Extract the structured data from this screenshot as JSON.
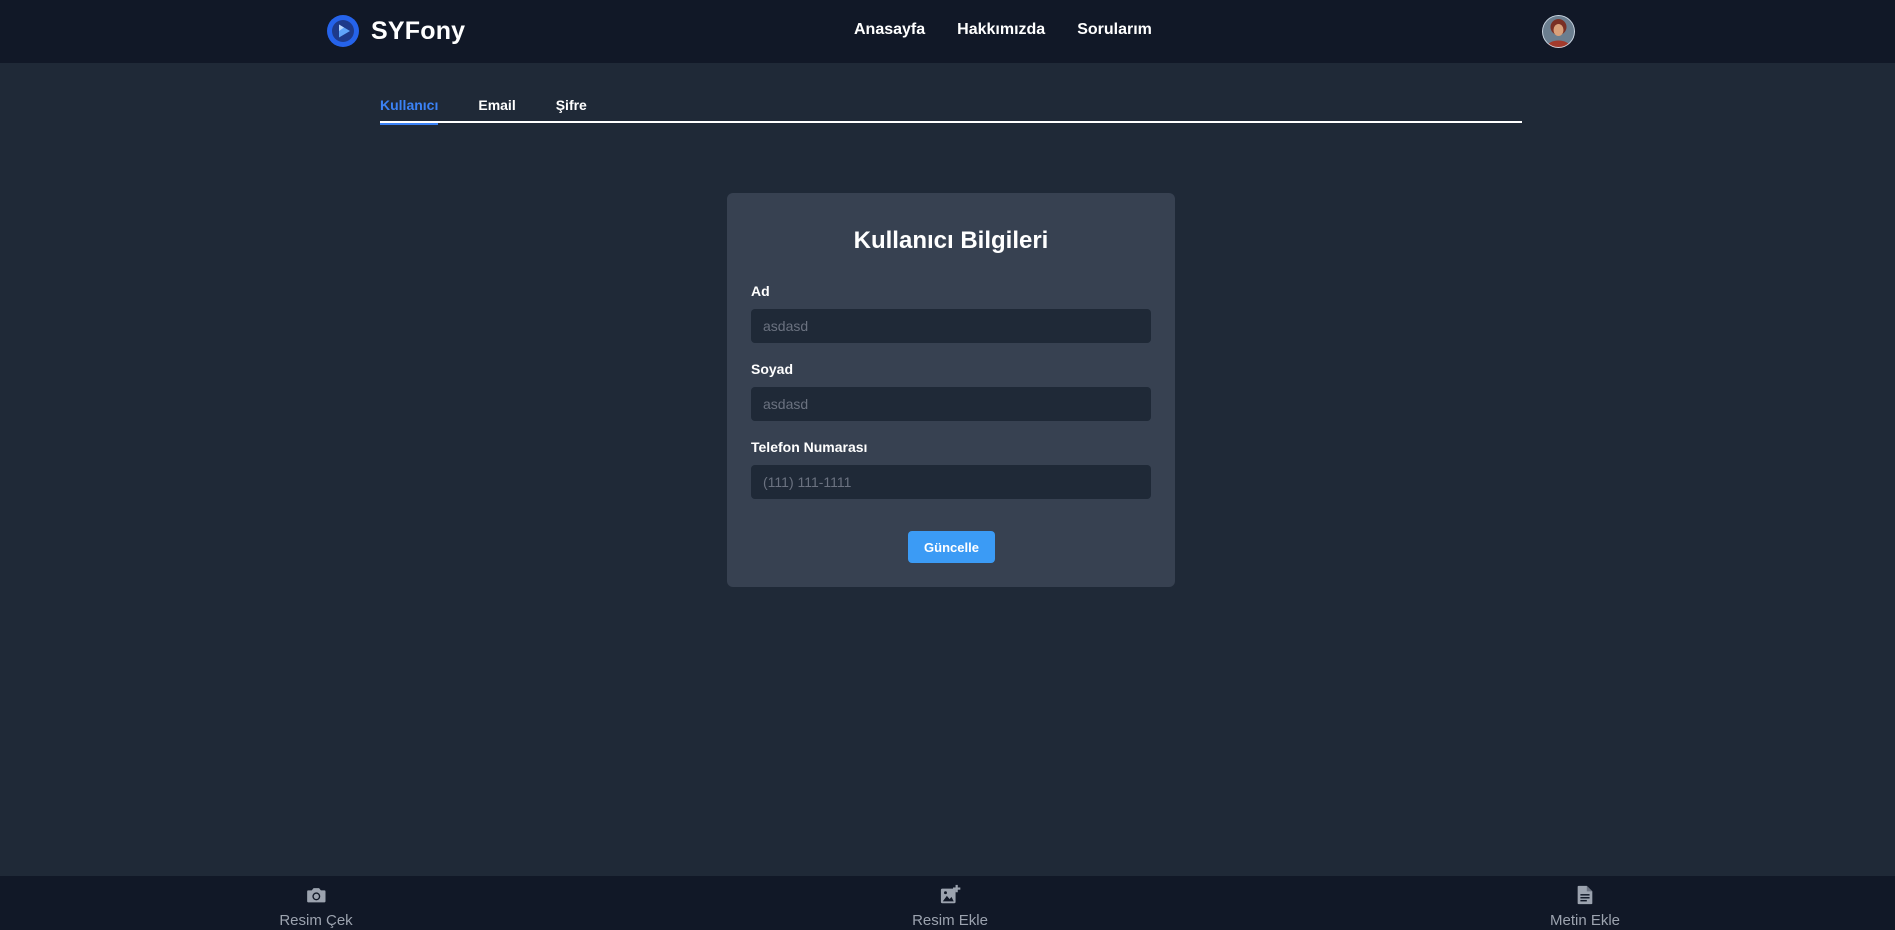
{
  "navbar": {
    "brand": "SYFony",
    "links": [
      "Anasayfa",
      "Hakkımızda",
      "Sorularım"
    ]
  },
  "tabs": [
    {
      "label": "Kullanıcı",
      "active": true
    },
    {
      "label": "Email",
      "active": false
    },
    {
      "label": "Şifre",
      "active": false
    }
  ],
  "form": {
    "title": "Kullanıcı Bilgileri",
    "fields": [
      {
        "label": "Ad",
        "value": "",
        "placeholder": "asdasd"
      },
      {
        "label": "Soyad",
        "value": "",
        "placeholder": "asdasd"
      },
      {
        "label": "Telefon Numarası",
        "value": "",
        "placeholder": "(111) 111-1111"
      }
    ],
    "submit_label": "Güncelle"
  },
  "bottom_bar": {
    "items": [
      {
        "label": "Resim Çek",
        "icon": "camera-icon"
      },
      {
        "label": "Resim Ekle",
        "icon": "add-image-icon"
      },
      {
        "label": "Metin Ekle",
        "icon": "document-icon"
      }
    ]
  },
  "colors": {
    "background": "#1f2937",
    "navbar": "#111827",
    "card": "#374151",
    "accent": "#3b82f6",
    "button": "#3b9bf5"
  }
}
